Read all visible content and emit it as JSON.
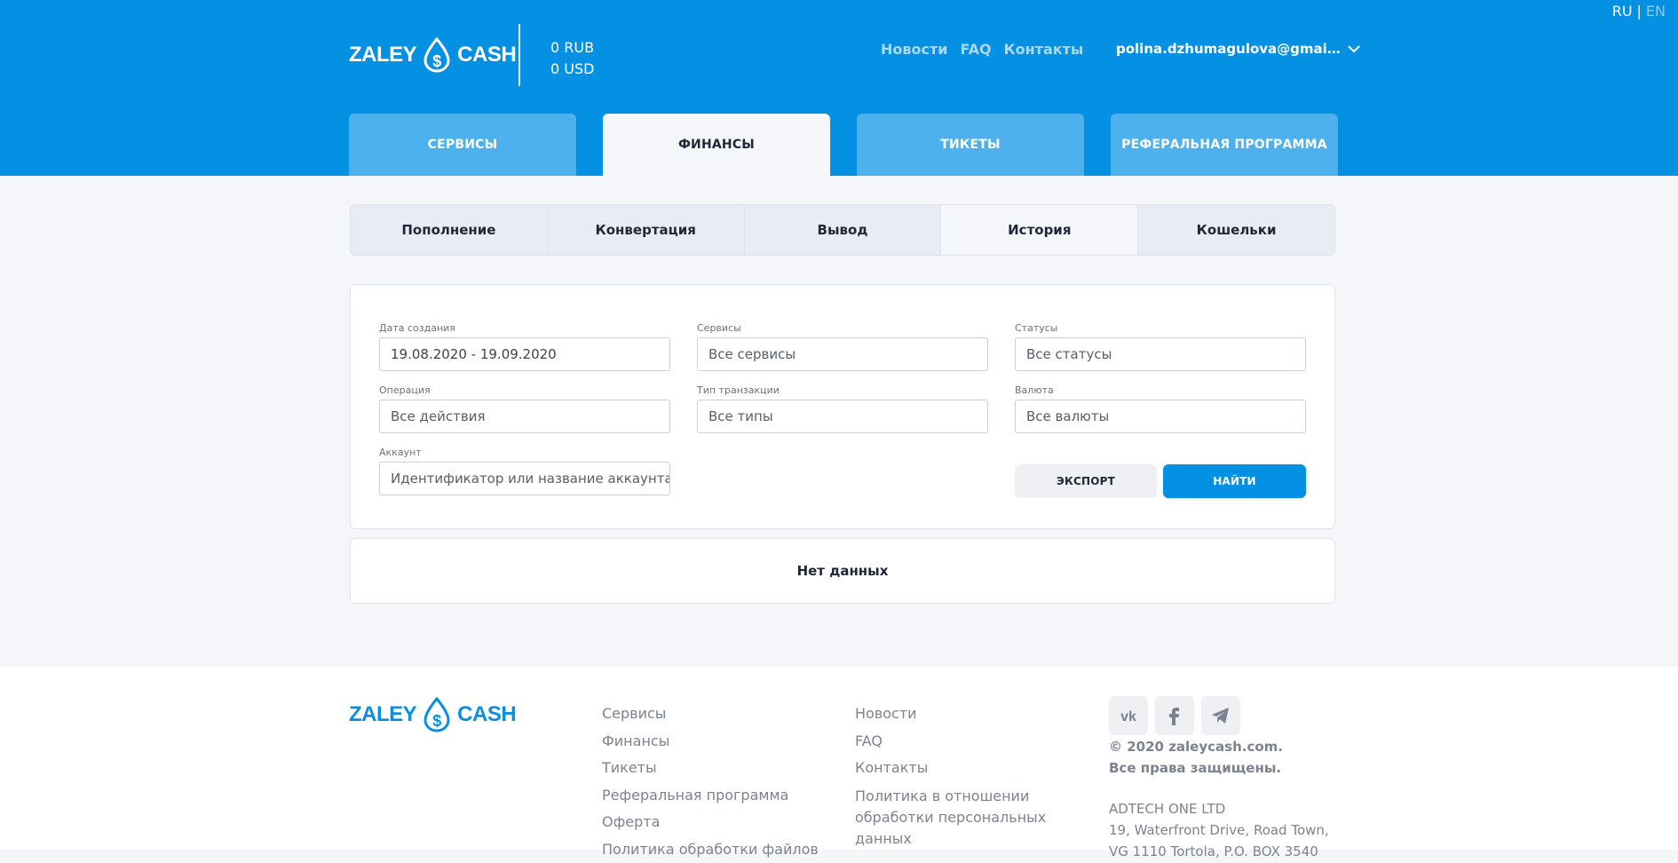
{
  "lang": {
    "ru": "RU",
    "sep": "|",
    "en": "EN"
  },
  "brand": {
    "left": "ZALEY",
    "right": "CASH"
  },
  "balance": {
    "rub": "0 RUB",
    "usd": "0 USD"
  },
  "topnav": [
    "Новости",
    "FAQ",
    "Контакты"
  ],
  "user": {
    "email": "polina.dzhumagulova@gmai…"
  },
  "tabs": [
    {
      "label": "СЕРВИСЫ"
    },
    {
      "label": "ФИНАНСЫ"
    },
    {
      "label": "ТИКЕТЫ"
    },
    {
      "label": "РЕФЕРАЛЬНАЯ ПРОГРАММА"
    }
  ],
  "subtabs": [
    "Пополнение",
    "Конвертация",
    "Вывод",
    "История",
    "Кошельки"
  ],
  "filters": {
    "date": {
      "label": "Дата создания",
      "value": "19.08.2020 - 19.09.2020"
    },
    "services": {
      "label": "Сервисы",
      "value": "Все сервисы"
    },
    "statuses": {
      "label": "Статусы",
      "value": "Все статусы"
    },
    "operation": {
      "label": "Операция",
      "value": "Все действия"
    },
    "tx_type": {
      "label": "Тип транзакции",
      "value": "Все типы"
    },
    "currency": {
      "label": "Валюта",
      "value": "Все валюты"
    },
    "account": {
      "label": "Аккаунт",
      "placeholder": "Идентификатор или название аккаунта"
    },
    "export_label": "ЭКСПОРТ",
    "find_label": "НАЙТИ"
  },
  "results": {
    "empty": "Нет данных"
  },
  "footer": {
    "col1": [
      "Сервисы",
      "Финансы",
      "Тикеты",
      "Реферальная программа",
      "Оферта",
      "Политика обработки файлов"
    ],
    "col2": [
      "Новости",
      "FAQ",
      "Контакты"
    ],
    "col2_policy": "Политика в отношении обработки персональных данных",
    "copyright1": "© 2020 zaleycash.com.",
    "copyright2": "Все права защищены.",
    "company": "ADTECH ONE LTD",
    "address": "19, Waterfront Drive, Road Town,",
    "address2": "VG 1110 Tortola, P.O. BOX 3540"
  },
  "colors": {
    "primary": "#0490e3",
    "tab_inactive": "#4db1ee",
    "bg": "#f4f6fa"
  }
}
